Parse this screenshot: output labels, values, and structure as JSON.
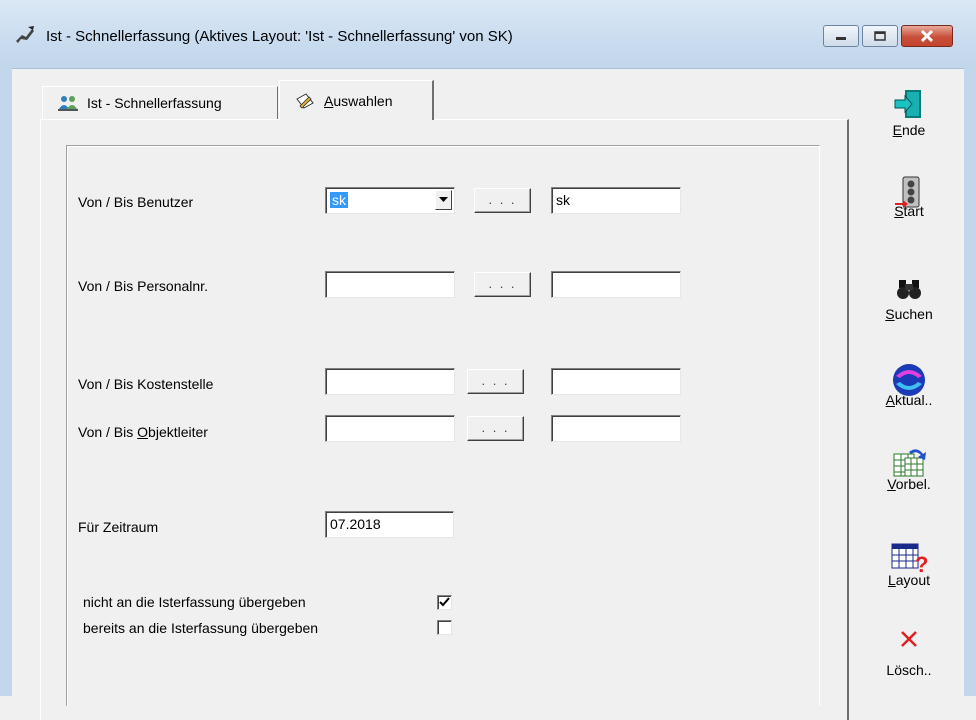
{
  "window": {
    "title": "Ist - Schnellerfassung  (Aktives Layout: 'Ist - Schnellerfassung' von SK)",
    "app_icon": "hand-pen-icon"
  },
  "tabs": [
    {
      "label": "Ist - Schnellerfassung",
      "icon": "people-icon",
      "active": false
    },
    {
      "label_prefix": "",
      "label_mnemonic": "A",
      "label_rest": "uswahlen",
      "icon": "pencil-note-icon",
      "active": true
    }
  ],
  "form": {
    "benutzer": {
      "label": "Von / Bis Benutzer",
      "from": "sk",
      "to": "sk",
      "browse": ". . ."
    },
    "personalnr": {
      "label": "Von / Bis Personalnr.",
      "from": "",
      "to": "",
      "browse": ". . ."
    },
    "kostenstelle": {
      "label": "Von / Bis Kostenstelle",
      "from": "",
      "to": "",
      "browse": ". . ."
    },
    "objektleiter": {
      "label_pre": "Von / Bis ",
      "label_mnemonic": "O",
      "label_rest": "bjektleiter",
      "from": "",
      "to": "",
      "browse": ". . ."
    },
    "zeitraum": {
      "label": "Für Zeitraum",
      "value": "07.2018"
    },
    "nicht_uebergeben": {
      "label": "nicht an die Isterfassung übergeben",
      "checked": true
    },
    "bereits_uebergeben": {
      "label": "bereits an die Isterfassung übergeben",
      "checked": false
    }
  },
  "toolbar": {
    "ende": {
      "mn": "E",
      "rest": "nde",
      "icon": "exit-door-icon"
    },
    "start": {
      "mn": "S",
      "rest": "tart",
      "icon": "traffic-light-icon"
    },
    "suchen": {
      "mn": "S",
      "rest": "uchen",
      "icon": "binoculars-icon"
    },
    "aktual": {
      "mn": "A",
      "rest": "ktual..",
      "icon": "refresh-icon"
    },
    "vorbel": {
      "mn": "V",
      "rest": "orbel.",
      "icon": "table-arrow-icon"
    },
    "layout": {
      "mn": "L",
      "rest": "ayout",
      "icon": "table-question-icon"
    },
    "loesch": {
      "mn": "",
      "rest": "Lösch..",
      "icon": "delete-x-icon"
    }
  },
  "colors": {
    "selection": "#3399ff",
    "titlebar": "#c9dcef",
    "close": "#c7503a"
  }
}
